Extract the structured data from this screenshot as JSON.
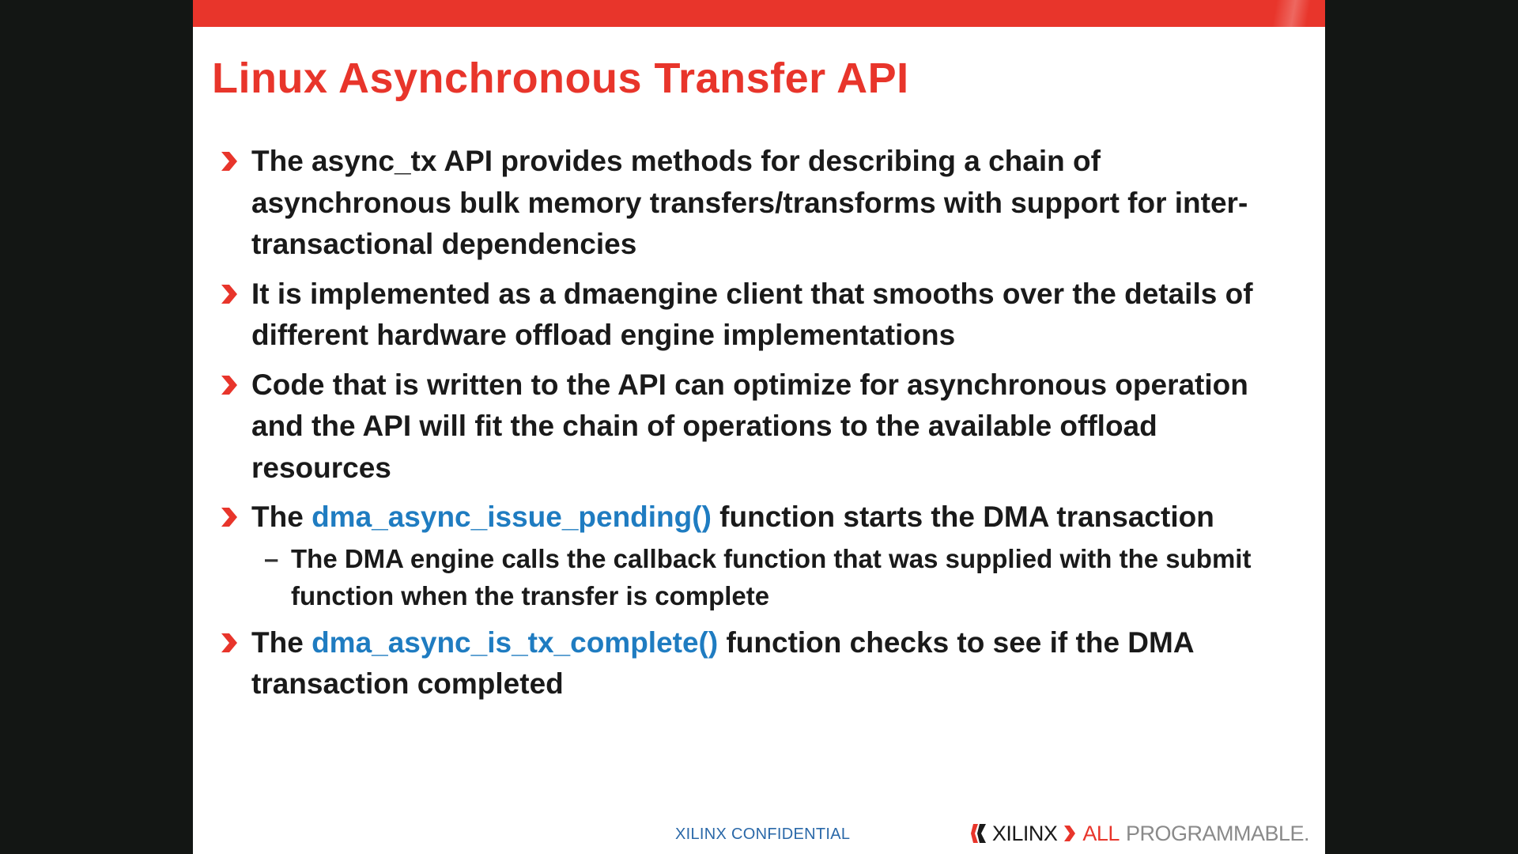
{
  "slide": {
    "title": "Linux Asynchronous Transfer API",
    "bullets": [
      {
        "text": "The async_tx API provides methods for describing a chain of asynchronous bulk memory transfers/transforms with support for inter-transactional dependencies"
      },
      {
        "text": "It is implemented as a dmaengine client that smooths over the details of different hardware offload engine implementations"
      },
      {
        "text": "Code that is written to the API can optimize for asynchronous operation and the API will fit the chain of operations to the available offload resources"
      },
      {
        "pre": "The ",
        "fn": "dma_async_issue_pending()",
        "post": " function starts the DMA transaction",
        "sub": {
          "dash": "–",
          "text": "The DMA engine calls the callback function that was supplied with the submit function when the transfer is complete"
        }
      },
      {
        "pre": "The ",
        "fn": "dma_async_is_tx_complete()",
        "post": " function checks to see if the DMA transaction completed"
      }
    ],
    "footer": {
      "confidential": "XILINX CONFIDENTIAL",
      "logo_icon": "xilinx-logo-icon",
      "logo_xilinx": "XILINX",
      "logo_all": "ALL",
      "logo_programmable": "PROGRAMMABLE."
    }
  },
  "colors": {
    "accent_red": "#e8352b",
    "function_blue": "#1f7cc1",
    "text": "#1a1a1a",
    "background": "#131614"
  }
}
